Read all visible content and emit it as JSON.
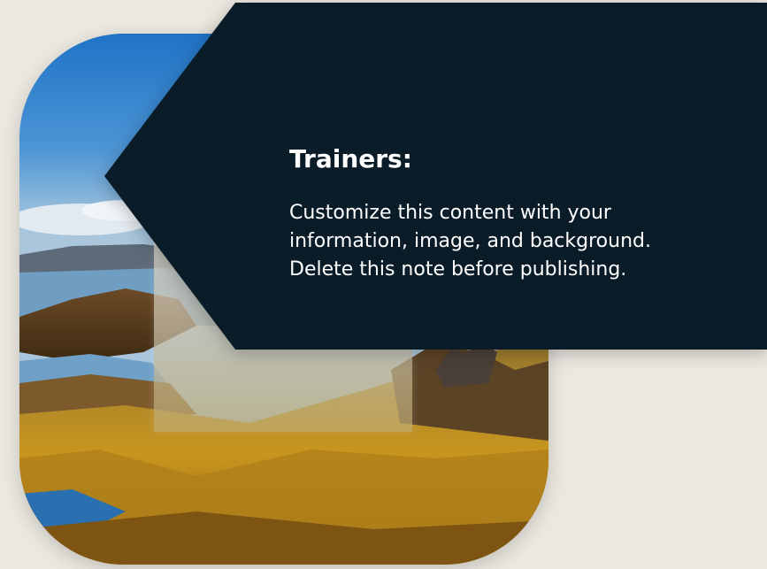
{
  "note": {
    "heading": "Trainers:",
    "lines": [
      "Customize this content with your",
      "information, image, and background.",
      "Delete this note before publishing."
    ]
  },
  "colors": {
    "background": "#ebe8e1",
    "note_fill": "#0b1c29",
    "note_text": "#ffffff"
  },
  "image": {
    "subject": "mountain-lake-landscape"
  }
}
